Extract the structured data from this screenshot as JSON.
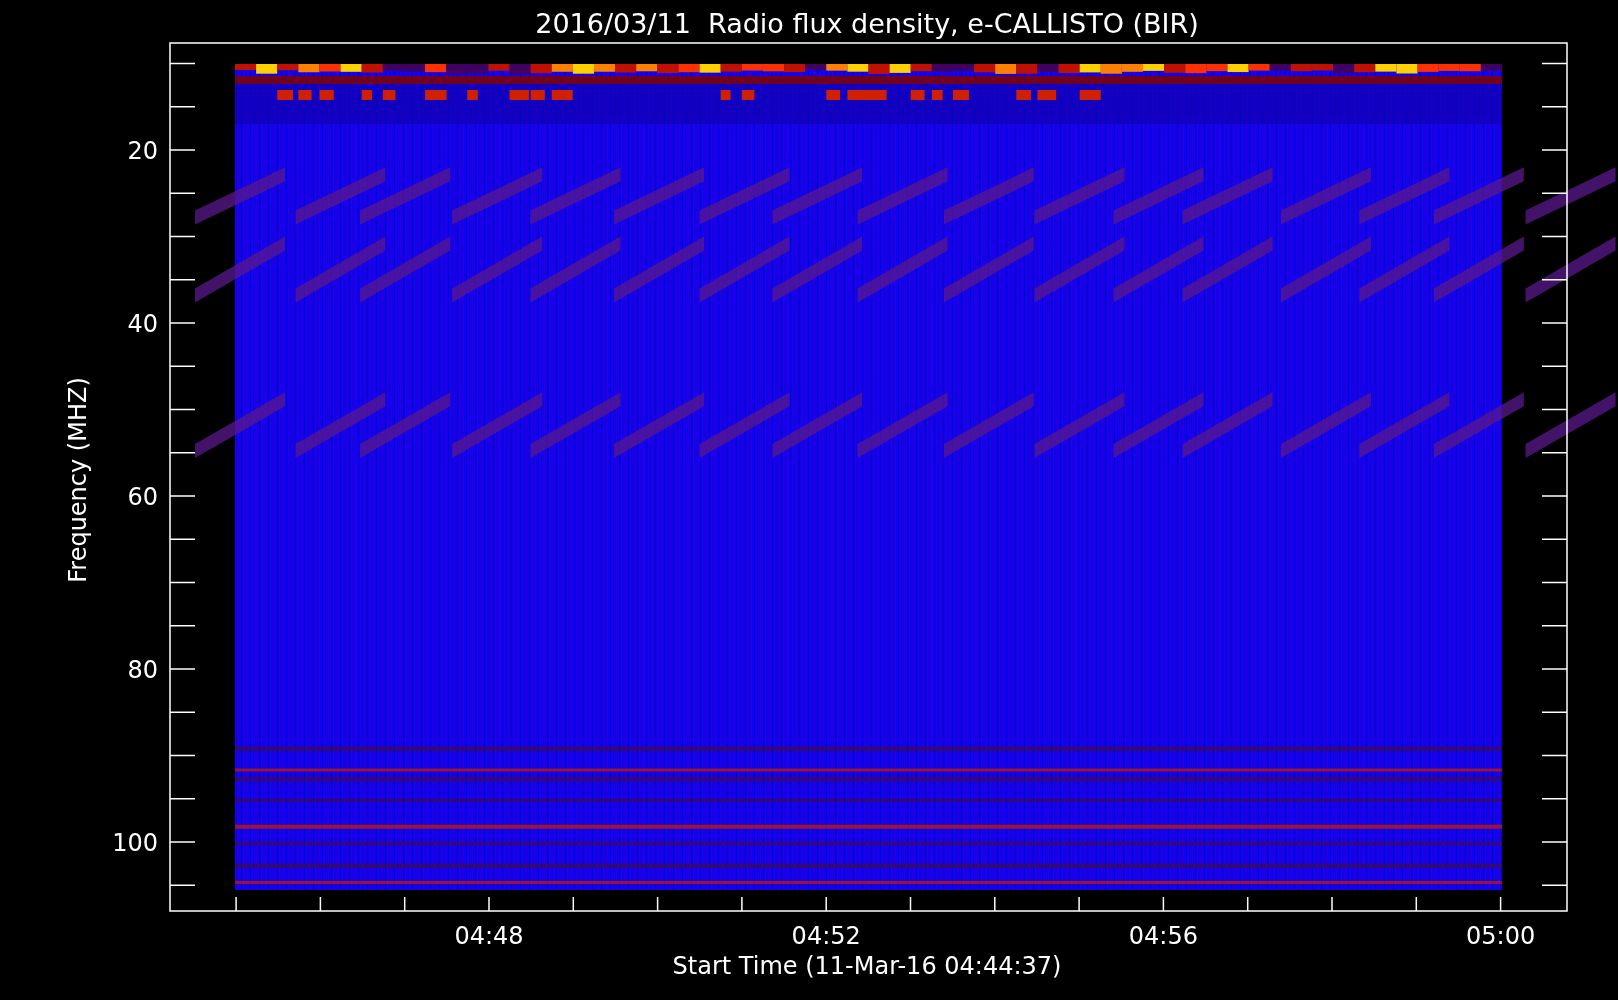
{
  "title": "2016/03/11  Radio flux density, e-CALLISTO (BIR)",
  "y_axis": {
    "label": "Frequency (MHZ)",
    "ticks": [
      "20",
      "40",
      "60",
      "80",
      "100"
    ]
  },
  "x_axis": {
    "label": "Start Time (11-Mar-16 04:44:37)",
    "ticks": [
      "04:48",
      "04:52",
      "04:56",
      "05:00"
    ]
  }
}
